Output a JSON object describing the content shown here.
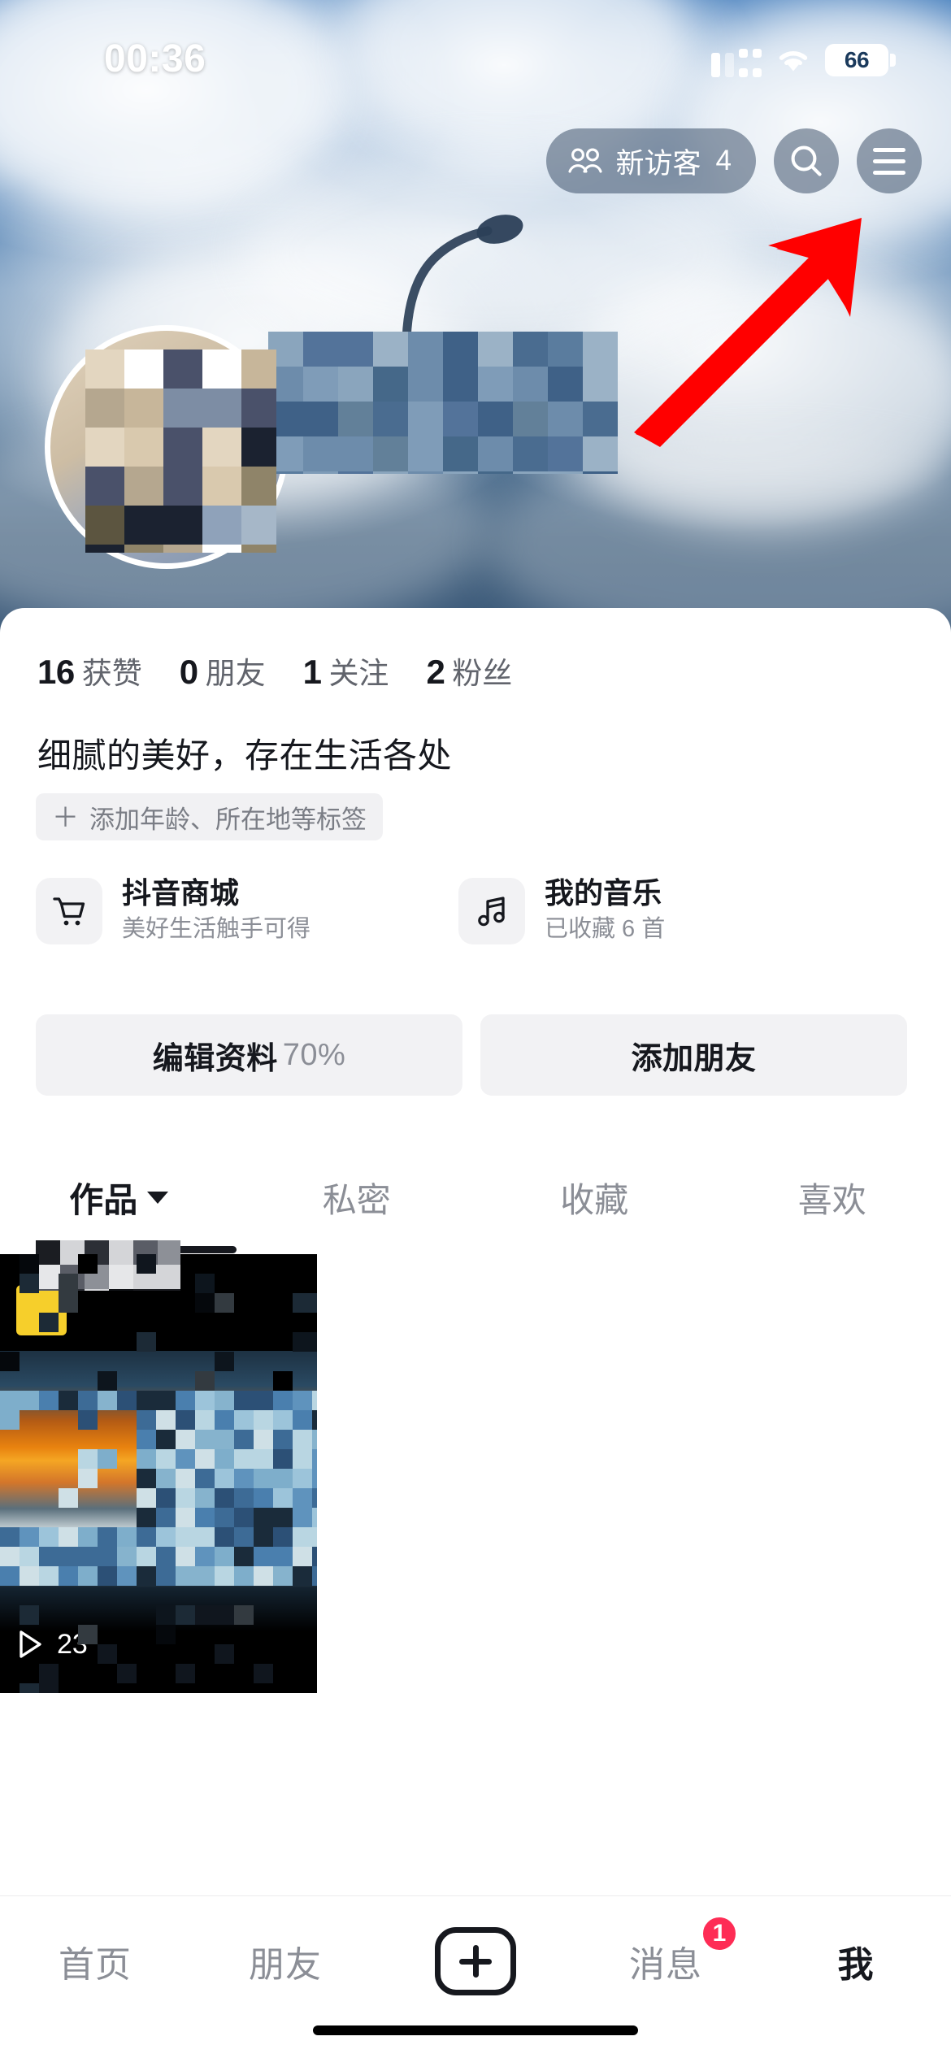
{
  "status_bar": {
    "time": "00:36",
    "battery_level": "66",
    "cellular_icon": "cellular-signal-icon",
    "wifi_icon": "wifi-icon",
    "battery_icon": "battery-icon"
  },
  "header": {
    "visitors_label": "新访客",
    "visitors_count": "4",
    "visitors_icon": "people-icon",
    "search_icon": "search-icon",
    "menu_icon": "hamburger-menu-icon",
    "annotation_arrow": "red-arrow-icon",
    "annotation_color": "#FF0000",
    "cover_image": "sky-clouds-street-lamp-photo",
    "avatar": "user-avatar-blurred",
    "username": "[已打码]"
  },
  "profile": {
    "stats": [
      {
        "value": "16",
        "label": "获赞",
        "redacted": true
      },
      {
        "value": "0",
        "label": "朋友",
        "redacted": false
      },
      {
        "value": "1",
        "label": "关注",
        "redacted": false
      },
      {
        "value": "2",
        "label": "粉丝",
        "redacted": false
      }
    ],
    "bio": "细腻的美好，存在生活各处",
    "add_tag_label": "添加年龄、所在地等标签",
    "add_tag_plus": "＋"
  },
  "entries": [
    {
      "icon": "shopping-cart-icon",
      "title": "抖音商城",
      "subtitle": "美好生活触手可得"
    },
    {
      "icon": "music-note-icon",
      "title": "我的音乐",
      "subtitle": "已收藏 6 首"
    }
  ],
  "actions": {
    "edit_profile_label": "编辑资料",
    "edit_profile_percent": "70%",
    "add_friend_label": "添加朋友"
  },
  "tabs": [
    {
      "label": "作品",
      "active": true,
      "has_caret": true
    },
    {
      "label": "私密",
      "active": false,
      "has_caret": false
    },
    {
      "label": "收藏",
      "active": false,
      "has_caret": false
    },
    {
      "label": "喜欢",
      "active": false,
      "has_caret": false
    }
  ],
  "works": [
    {
      "play_count": "23",
      "play_icon": "play-triangle-icon",
      "badge": "yellow-pin-badge",
      "thumbnail": "sunset-ocean-beach-photo"
    }
  ],
  "bottom_nav": {
    "items": [
      {
        "label": "首页",
        "active": false,
        "badge": ""
      },
      {
        "label": "朋友",
        "active": false,
        "badge": ""
      },
      {
        "label": "",
        "active": false,
        "badge": "",
        "icon": "plus-create-icon"
      },
      {
        "label": "消息",
        "active": false,
        "badge": "1"
      },
      {
        "label": "我",
        "active": true,
        "badge": ""
      }
    ],
    "badge_color": "#FE2C55"
  }
}
